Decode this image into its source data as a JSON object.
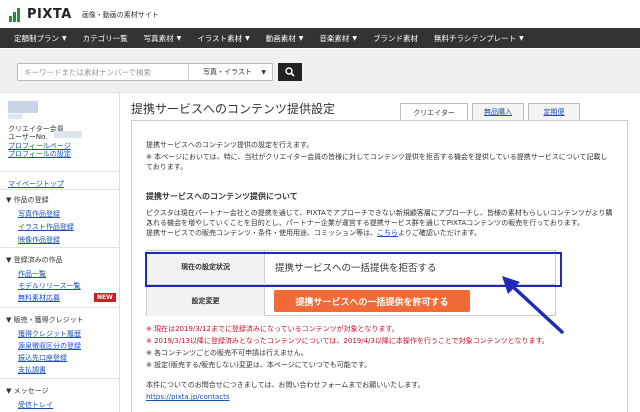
{
  "header": {
    "logo_text": "PIXTA",
    "logo_sub": "画像・動画の素材サイト"
  },
  "nav": [
    {
      "label": "定額制プラン",
      "caret": true
    },
    {
      "label": "カテゴリ一覧",
      "caret": false
    },
    {
      "label": "写真素材",
      "caret": true
    },
    {
      "label": "イラスト素材",
      "caret": true
    },
    {
      "label": "動画素材",
      "caret": true
    },
    {
      "label": "音楽素材",
      "caret": true
    },
    {
      "label": "ブランド素材",
      "caret": false
    },
    {
      "label": "無料チラシテンプレート",
      "caret": true
    }
  ],
  "search": {
    "placeholder": "キーワードまたは素材ナンバーで検索",
    "select_value": "写真・イラスト"
  },
  "sidebar": {
    "member_label": "クリエイター会員",
    "user_no_label": "ユーザーNo.",
    "profile_page": "プロフィールページ",
    "profile_settings": "プロフィールの設定",
    "mypage_top": "マイページトップ",
    "sections": [
      {
        "title": "作品の登録",
        "items": [
          "写真作品登録",
          "イラスト作品登録",
          "映像作品登録"
        ]
      },
      {
        "title": "登録済みの作品",
        "items": [
          "作品一覧",
          "モデルリリース一覧",
          "無料素材応募"
        ]
      },
      {
        "title": "販売・獲得クレジット",
        "items": [
          "獲得クレジット履歴",
          "源泉徴収区分の登録",
          "振込先口座登録",
          "支払調書"
        ]
      },
      {
        "title": "メッセージ",
        "items": [
          "受信トレイ"
        ]
      }
    ],
    "new_badge": "NEW"
  },
  "main": {
    "title": "提携サービスへのコンテンツ提供設定",
    "tabs": [
      {
        "label": "クリエイター",
        "active": true
      },
      {
        "label": "無品購入",
        "active": false
      },
      {
        "label": "定期便",
        "active": false
      }
    ],
    "intro_line1": "提携サービスへのコンテンツ提供の設定を行えます。",
    "intro_line2": "※ 本ページにおいては、特に、当社がクリエイター会員の皆様に対してコンテンツ提供を拒否する機会を提供している提携サービスについて記載し",
    "intro_line3": "ております。",
    "section_title": "提携サービスへのコンテンツ提供について",
    "about_line1": "ピクスタは現在パートナー会社との提携を通じて、PIXTAでアプローチできない新規顧客層にアプローチし、皆様の素材もらしいコンテンツがより購入",
    "about_line2": "される機会を増やしていくことを目的とし、パートナー企業が運営する提携サービス群を通じてPIXTAコンテンツの販売を行っております。",
    "about_line3_pre": "提携サービスでの販売コンテンツ・条件・使用用途、コミッション等は、",
    "about_line3_link": "こちら",
    "about_line3_post": "よりご確認いただけます。",
    "settings": {
      "current_label": "現在の設定状況",
      "current_value": "提携サービスへの一括提供を拒否する",
      "change_label": "設定変更",
      "permit_button": "提携サービスへの一括提供を許可する"
    },
    "notes_red": [
      "※ 現在は2019/3/12までに登録済みになっているコンテンツが対象となります。",
      "※ 2019/3/13以降に登録済みとなったコンテンツについては、2019/4/3以降に本操作を行うことで対象コンテンツとなります。"
    ],
    "notes_black": [
      "※ 各コンテンツごとの販売不可申請は行えません。",
      "※ 設定(販売する/販売しない)変更は、本ページにていつでも可能です。"
    ],
    "contact_line": "本件についてのお問合せにつきましては、お問い合わせフォームまでお願いいたします。",
    "contact_url": "https://pixta.jp/contacts"
  },
  "colors": {
    "nav_bg": "#333333",
    "accent_orange": "#f26a35",
    "highlight_blue": "#1f2bb8",
    "link_blue": "#1a4fb4",
    "note_red": "#c8102e",
    "logo_green": "#2a8c3c"
  }
}
